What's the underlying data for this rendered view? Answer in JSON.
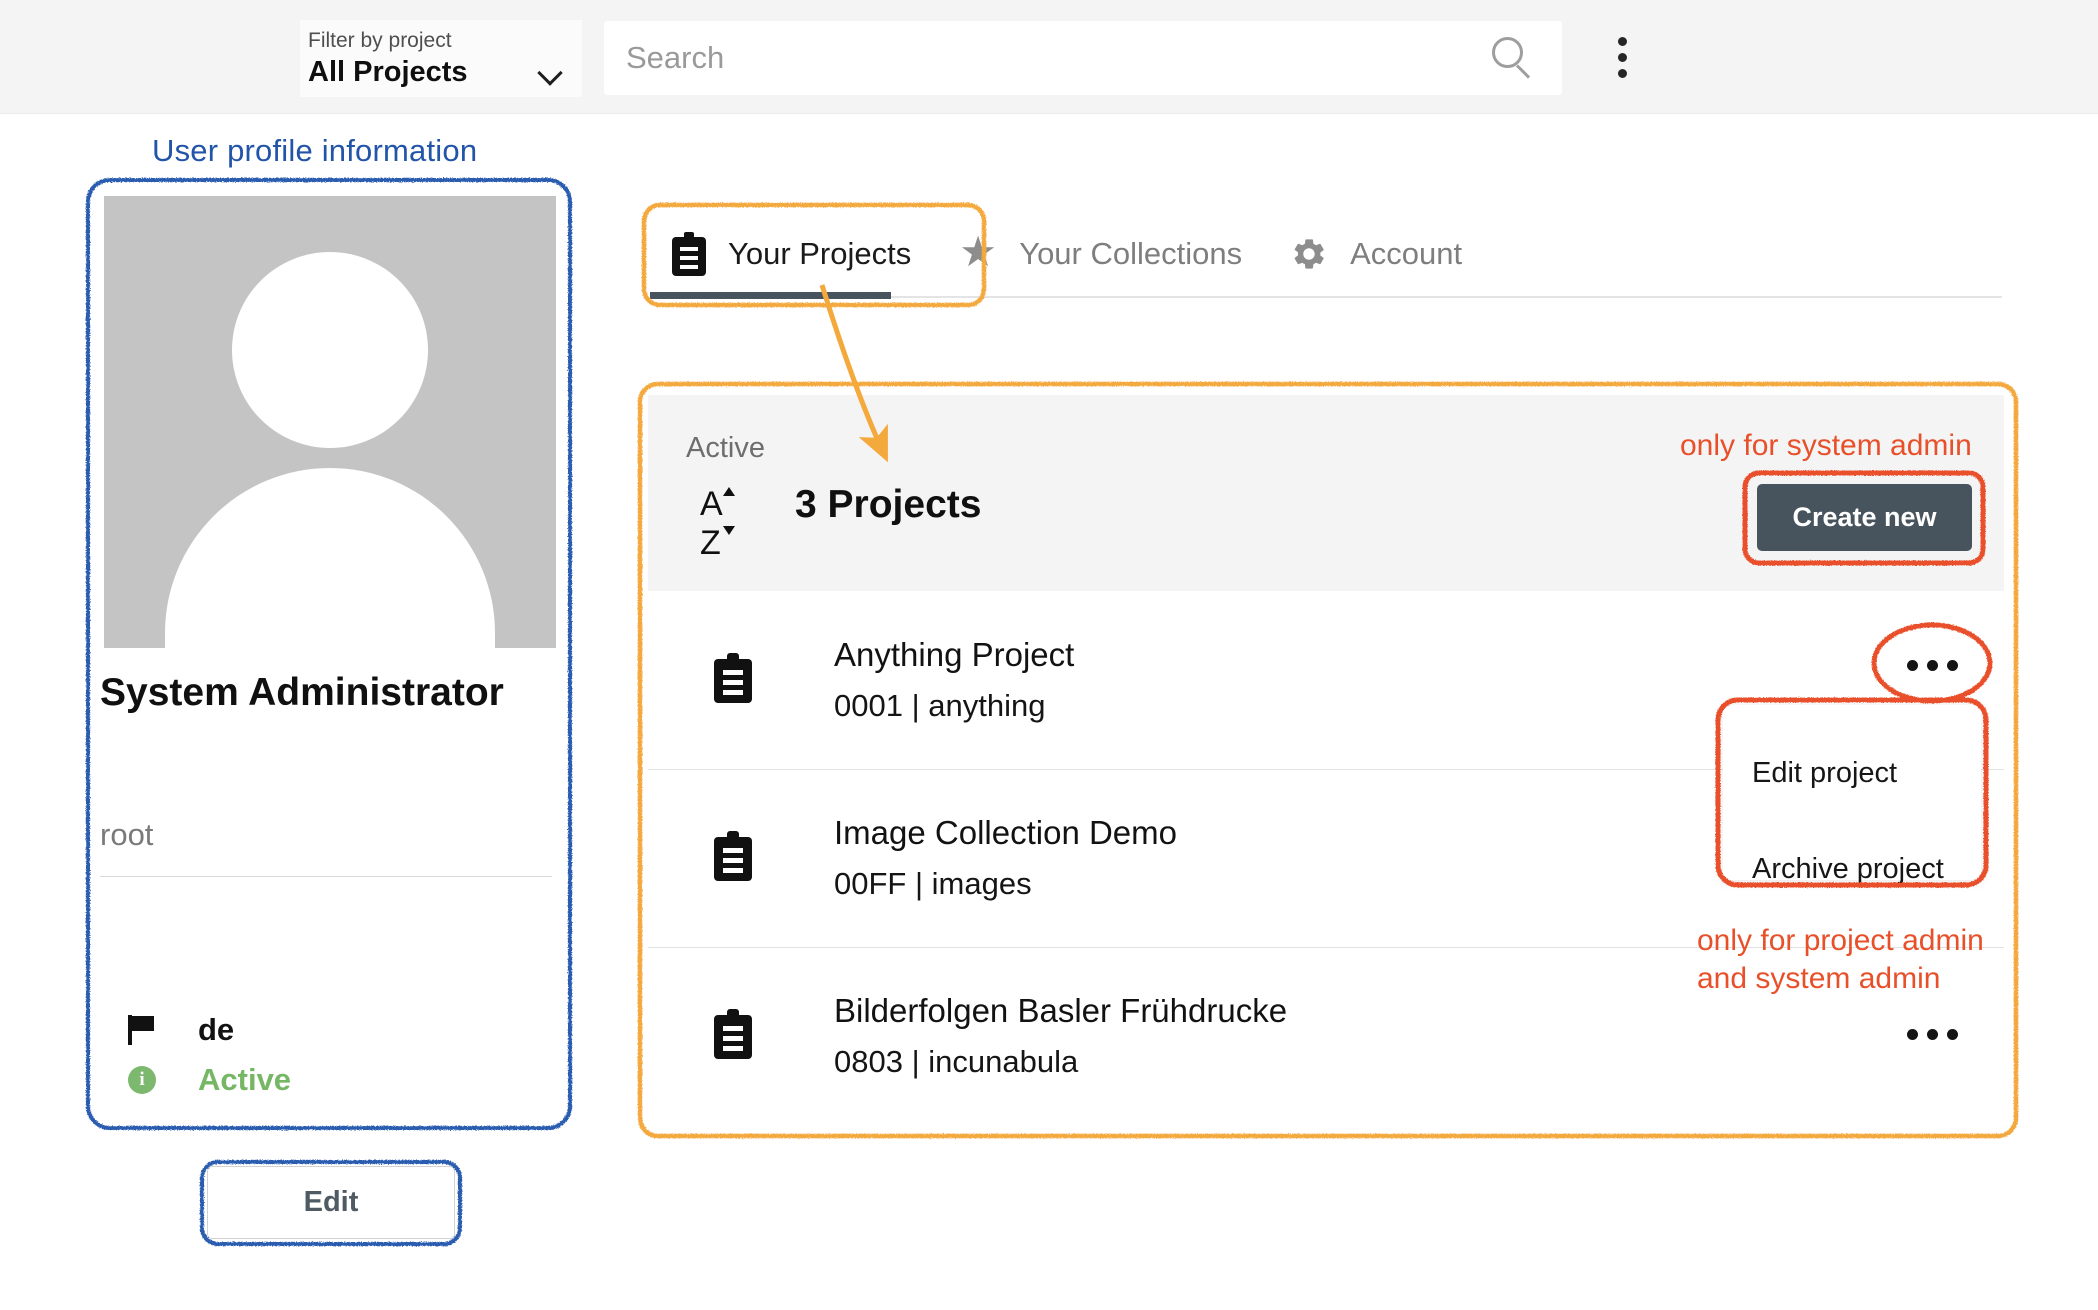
{
  "topbar": {
    "filter_label": "Filter by project",
    "filter_value": "All Projects",
    "chevron_icon": "chevron-down-icon",
    "search_placeholder": "Search",
    "search_value": "",
    "search_icon": "search-icon",
    "overflow_icon": "kebab-vertical-icon"
  },
  "profile": {
    "annotation_label": "User profile information",
    "avatar_icon": "user-avatar-placeholder",
    "name": "System Administrator",
    "username": "root",
    "language_icon": "flag-icon",
    "language": "de",
    "status_icon": "info-circle-icon",
    "status": "Active",
    "status_color": "#76b765",
    "edit_label": "Edit"
  },
  "tabs": [
    {
      "label": "Your Projects",
      "icon": "clipboard-icon",
      "active": true
    },
    {
      "label": "Your Collections",
      "icon": "star-icon",
      "active": false
    },
    {
      "label": "Account",
      "icon": "gear-icon",
      "active": false
    }
  ],
  "projects_panel": {
    "state_label": "Active",
    "sort_icon": "sort-az-icon",
    "sort_letter_a": "A",
    "sort_letter_z": "Z",
    "count_label": "3 Projects",
    "create_new_label": "Create new",
    "rows": [
      {
        "icon": "clipboard-icon",
        "title": "Anything Project",
        "subtitle": "0001 | anything",
        "menu_icon": "kebab-horizontal-icon"
      },
      {
        "icon": "clipboard-icon",
        "title": "Image Collection Demo",
        "subtitle": "00FF | images",
        "menu_icon": "kebab-horizontal-icon"
      },
      {
        "icon": "clipboard-icon",
        "title": "Bilderfolgen Basler Frühdrucke",
        "subtitle": "0803 | incunabula",
        "menu_icon": "kebab-horizontal-icon"
      }
    ]
  },
  "context_menu": {
    "edit_label": "Edit project",
    "archive_label": "Archive project"
  },
  "annotations": {
    "blue_color": "#2255a8",
    "orange_color": "#f3a93c",
    "red_color": "#e8502a",
    "system_admin_note": "only for system admin",
    "project_admin_note": "only for project admin\nand system admin"
  }
}
